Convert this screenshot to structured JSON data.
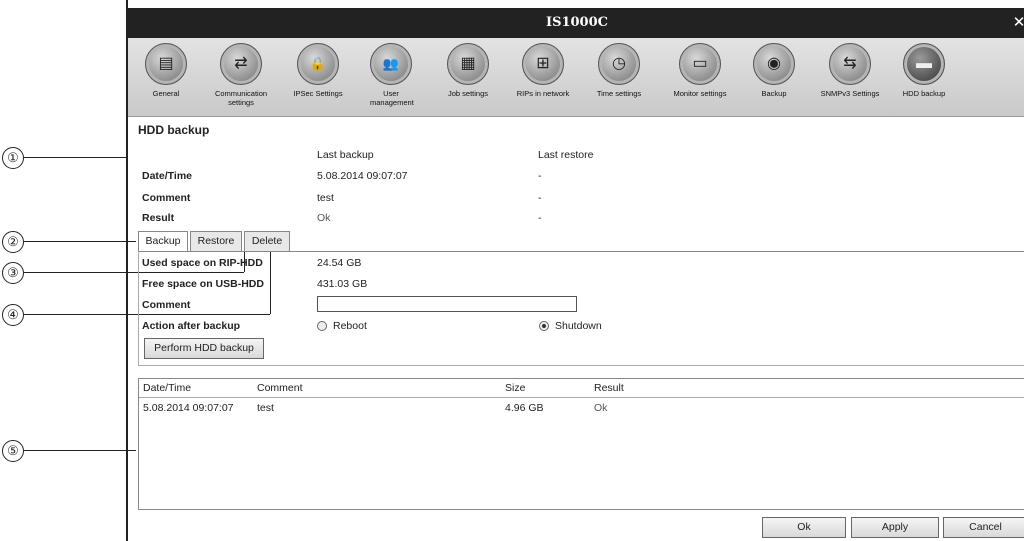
{
  "callouts": [
    "①",
    "②",
    "③",
    "④",
    "⑤"
  ],
  "window": {
    "title": "IS1000C",
    "close_symbol": "✕"
  },
  "toolbar": [
    {
      "label": "General",
      "icon": "rip-server-icon",
      "glyph": "▤",
      "active": false
    },
    {
      "label": "Communication settings",
      "icon": "communication-icon",
      "glyph": "⇄",
      "active": false
    },
    {
      "label": "IPSec Settings",
      "icon": "ipsec-lock-icon",
      "glyph": "🔒",
      "active": false
    },
    {
      "label": "User management",
      "icon": "users-icon",
      "glyph": "👥",
      "active": false
    },
    {
      "label": "Job settings",
      "icon": "job-document-icon",
      "glyph": "▦",
      "active": false
    },
    {
      "label": "RIPs in network",
      "icon": "network-icon",
      "glyph": "⊞",
      "active": false
    },
    {
      "label": "Time settings",
      "icon": "clock-icon",
      "glyph": "◷",
      "active": false
    },
    {
      "label": "Monitor settings",
      "icon": "monitor-icon",
      "glyph": "▭",
      "active": false
    },
    {
      "label": "Backup",
      "icon": "backup-disk-icon",
      "glyph": "◉",
      "active": false
    },
    {
      "label": "SNMPv3 Settings",
      "icon": "snmp-icon",
      "glyph": "⇆",
      "active": false
    },
    {
      "label": "HDD backup",
      "icon": "hdd-icon",
      "glyph": "▬",
      "active": true
    }
  ],
  "page_title": "HDD backup",
  "summary": {
    "col_last_backup": "Last backup",
    "col_last_restore": "Last restore",
    "rows": [
      {
        "label": "Date/Time",
        "backup": "5.08.2014 09:07:07",
        "restore": "-"
      },
      {
        "label": "Comment",
        "backup": "test",
        "restore": "-"
      },
      {
        "label": "Result",
        "backup": "Ok",
        "restore": "-"
      }
    ]
  },
  "tabs": [
    "Backup",
    "Restore",
    "Delete"
  ],
  "backup_form": {
    "used_space_label": "Used space on RIP-HDD",
    "used_space_value": "24.54 GB",
    "free_space_label": "Free space on USB-HDD",
    "free_space_value": "431.03 GB",
    "comment_label": "Comment",
    "comment_value": "",
    "action_label": "Action after backup",
    "option_reboot": "Reboot",
    "option_shutdown": "Shutdown",
    "selected_action": "Shutdown",
    "perform_button": "Perform HDD backup"
  },
  "history": {
    "headers": [
      "Date/Time",
      "Comment",
      "Size",
      "Result"
    ],
    "rows": [
      {
        "datetime": "5.08.2014 09:07:07",
        "comment": "test",
        "size": "4.96 GB",
        "result": "Ok"
      }
    ]
  },
  "footer": {
    "ok": "Ok",
    "apply": "Apply",
    "cancel": "Cancel"
  }
}
